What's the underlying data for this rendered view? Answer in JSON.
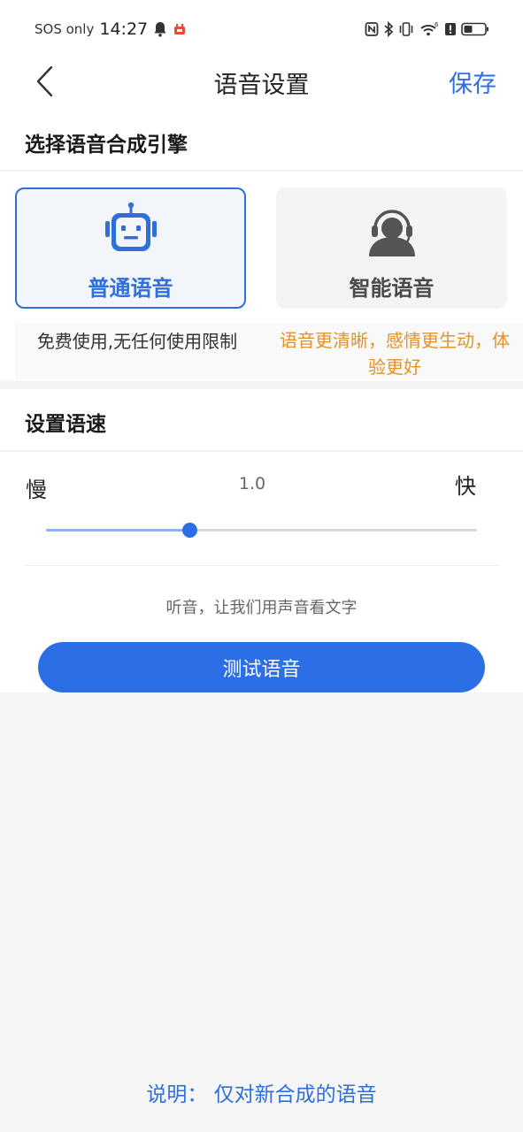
{
  "status_bar": {
    "carrier": "SOS only",
    "time": "14:27",
    "signal_badge": "6"
  },
  "header": {
    "title": "语音设置",
    "save_label": "保存"
  },
  "engine_section": {
    "title": "选择语音合成引擎",
    "options": [
      {
        "label": "普通语音",
        "icon": "robot-icon",
        "selected": true,
        "description": "免费使用,无任何使用限制"
      },
      {
        "label": "智能语音",
        "icon": "headset-user-icon",
        "selected": false,
        "description": "语音更清晰，感情更生动，体验更好"
      }
    ]
  },
  "speed_section": {
    "title": "设置语速",
    "slow_label": "慢",
    "fast_label": "快",
    "value": "1.0",
    "slider_fraction": 0.333,
    "hint": "听音，让我们用声音看文字",
    "test_button": "测试语音"
  },
  "footer": {
    "note": "说明：  仅对新合成的语音"
  },
  "colors": {
    "accent": "#2b6ee6",
    "selected_border": "#2f6fdc",
    "warm_text": "#e3922c"
  }
}
